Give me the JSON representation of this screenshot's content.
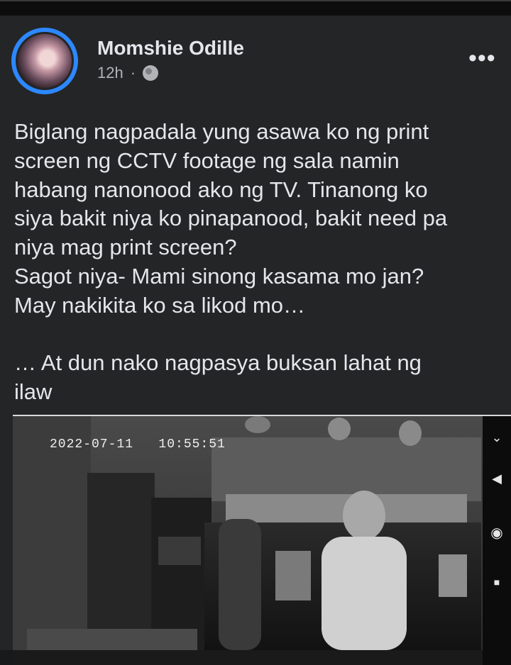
{
  "post": {
    "author": "Momshie Odille",
    "time": "12h",
    "separator": "·",
    "privacy_icon": "globe-icon",
    "more_icon": "more-horizontal-icon",
    "more_label": "•••",
    "body": "Biglang nagpadala yung asawa ko ng print\nscreen ng CCTV footage ng sala namin\nhabang nanonood ako ng TV. Tinanong ko\nsiya bakit niya ko pinapanood, bakit need pa\nniya mag print screen?\nSagot niya- Mami sinong kasama mo jan?\nMay nakikita ko sa likod mo…\n\n… At dun nako nagpasya buksan lahat ng\nilaw"
  },
  "photo": {
    "timestamp": "2022-07-11   10:55:51",
    "nav_icons": [
      "chevron-down-small-icon",
      "back-triangle-icon",
      "home-circle-icon",
      "recents-square-icon"
    ],
    "nav_glyphs": [
      "⌄",
      "◀",
      "◉",
      "■"
    ]
  },
  "colors": {
    "background": "#18191a",
    "card": "#242526",
    "text_primary": "#e4e6eb",
    "text_secondary": "#b0b3b8",
    "avatar_ring": "#2d88ff"
  }
}
